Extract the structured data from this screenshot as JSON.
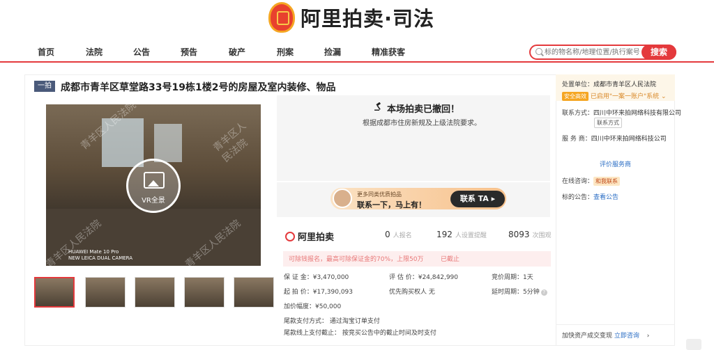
{
  "header": {
    "logo_text": "阿里拍卖·司法"
  },
  "nav": {
    "items": [
      "首页",
      "法院",
      "公告",
      "预告",
      "破产",
      "刑案",
      "捡漏",
      "精准获客"
    ]
  },
  "search": {
    "placeholder": "标的物名称/地理位置/执行案号",
    "button": "搜索"
  },
  "item": {
    "round_tag": "一拍",
    "title": "成都市青羊区草堂路33号19栋1楼2号的房屋及室内装修、物品",
    "vr_label": "VR全景",
    "camera_line1": "HUAWEI Mate 10 Pro",
    "camera_line2": "NEW LEICA DUAL CAMERA",
    "watermark": "青羊区人民法院"
  },
  "status": {
    "title": "本场拍卖已撤回！",
    "subtitle": "根据成都市住房新规及上级法院要求。"
  },
  "banner": {
    "line1": "更多同类优质拍品",
    "line2": "联系一下，马上有！",
    "button": "联系 TA ▸"
  },
  "stats": {
    "brand": "阿里拍卖",
    "signups": "0",
    "signups_label": "人报名",
    "reminders": "192",
    "reminders_label": "人设置提醒",
    "views": "8093",
    "views_label": "次围观"
  },
  "notice": {
    "text": "可除钱报名，最高可除保证金的70%，上限50万",
    "end": "已截止"
  },
  "details": {
    "deposit_label": "保 证 金：",
    "deposit": "¥3,470,000",
    "valuation_label": "评 估 价：",
    "valuation": "¥24,842,990",
    "cycle_label": "竞价周期：",
    "cycle": "1天",
    "start_label": "起 拍 价：",
    "start": "¥17,390,093",
    "priority_label": "优先购买权人",
    "priority": "无",
    "extend_label": "延时周期：",
    "extend": "5分钟",
    "increment_label": "加价幅度：",
    "increment": "¥50,000",
    "pay_method_label": "尾款支付方式：",
    "pay_method": "通过淘宝订单支付",
    "pay_deadline_label": "尾款线上支付截止：",
    "pay_deadline": "按竞买公告中的截止时间及时支付"
  },
  "side": {
    "court_label": "处置单位：",
    "court": "成都市青羊区人民法院",
    "security": "安全高效",
    "system": "已启用\"一案一账户\"系统 ⌄",
    "contact_label": "联系方式：",
    "contact": "四川中环来拍网络科技有限公司",
    "contact_btn": "联系方式",
    "provider_label": "服 务 商：",
    "provider": "四川中环来拍网络科技公司",
    "rate": "评价服务商",
    "online_label": "在线咨询：",
    "online_btn": "和我联系",
    "announce_label": "标的公告：",
    "announce": "查看公告",
    "bottom": "加快资产成交变现",
    "bottom_link": "立即咨询"
  }
}
